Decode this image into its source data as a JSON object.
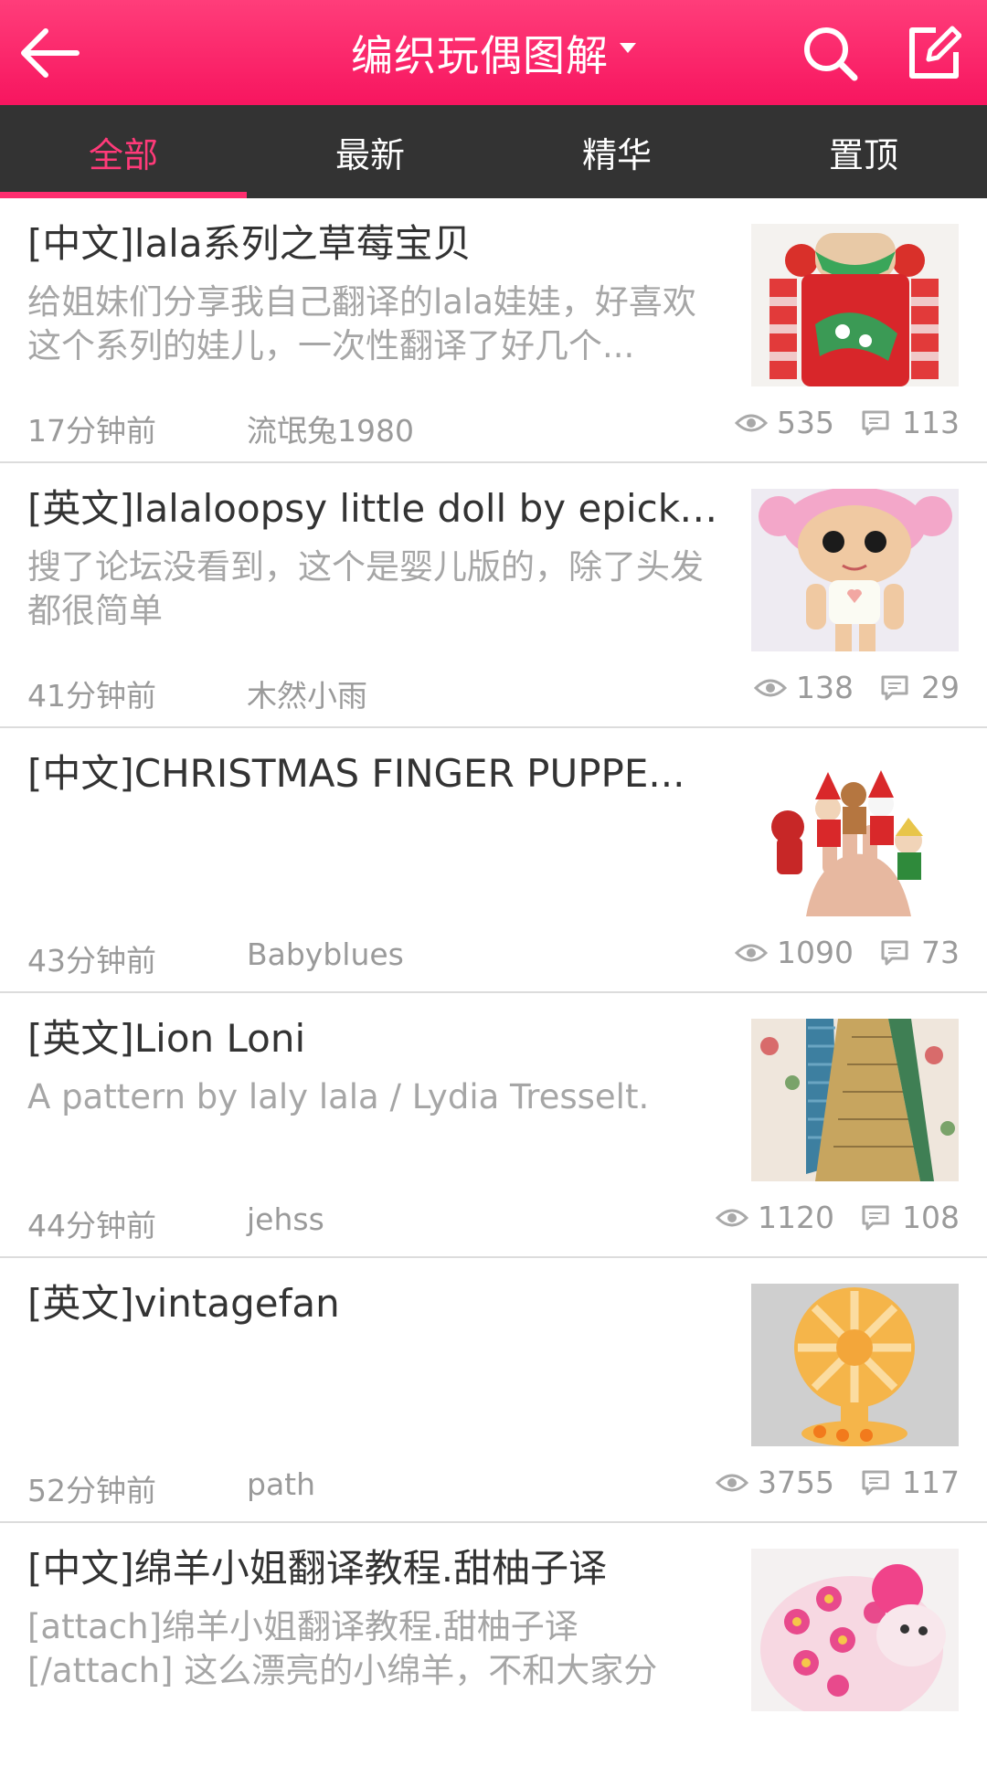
{
  "header": {
    "title": "编织玩偶图解"
  },
  "tabs": [
    {
      "label": "全部"
    },
    {
      "label": "最新"
    },
    {
      "label": "精华"
    },
    {
      "label": "置顶"
    }
  ],
  "posts": [
    {
      "title": "[中文]lala系列之草莓宝贝",
      "desc": "给姐妹们分享我自己翻译的lala娃娃，好喜欢这个系列的娃儿，一次性翻译了好几个...",
      "time": "17分钟前",
      "user": "流氓兔1980",
      "views": "535",
      "comments": "113"
    },
    {
      "title": "[英文]lalaloopsy little doll by epicka...",
      "desc": "搜了论坛没看到，这个是婴儿版的，除了头发都很简单",
      "time": "41分钟前",
      "user": "木然小雨",
      "views": "138",
      "comments": "29"
    },
    {
      "title": "[中文]CHRISTMAS FINGER PUPPE...",
      "desc": "",
      "time": "43分钟前",
      "user": "Babyblues",
      "views": "1090",
      "comments": "73"
    },
    {
      "title": "[英文]Lion Loni",
      "desc": "A pattern by laly lala / Lydia Tresselt.",
      "time": "44分钟前",
      "user": "jehss",
      "views": "1120",
      "comments": "108"
    },
    {
      "title": "[英文]vintagefan",
      "desc": "",
      "time": "52分钟前",
      "user": "path",
      "views": "3755",
      "comments": "117"
    },
    {
      "title": "[中文]绵羊小姐翻译教程.甜柚子译",
      "desc": "[attach]绵羊小姐翻译教程.甜柚子译[/attach] 这么漂亮的小绵羊，不和大家分",
      "time": "",
      "user": "",
      "views": "",
      "comments": ""
    }
  ]
}
